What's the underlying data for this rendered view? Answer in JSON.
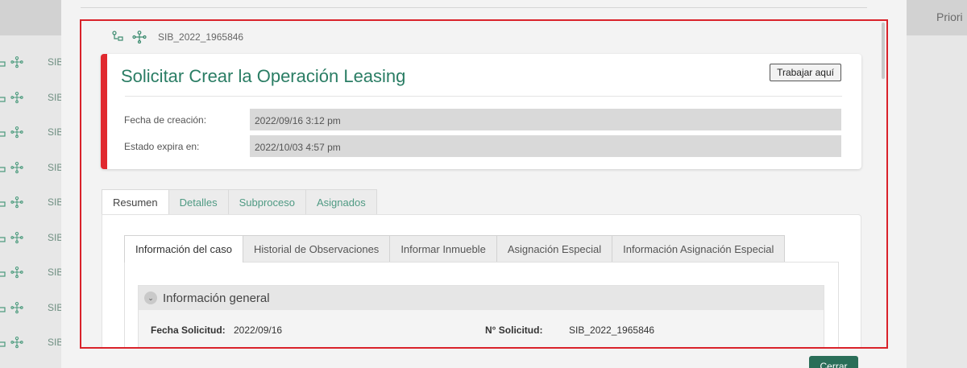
{
  "background": {
    "header_label": "Priori",
    "row_code": "SIB",
    "row_offsets": [
      0,
      1,
      2,
      3,
      4,
      5,
      6,
      7,
      8
    ]
  },
  "breadcrumb": {
    "case_code": "SIB_2022_1965846"
  },
  "card": {
    "title": "Solicitar Crear la Operación Leasing",
    "work_button": "Trabajar aquí",
    "fields": [
      {
        "label": "Fecha de creación:",
        "value": "2022/09/16 3:12 pm"
      },
      {
        "label": "Estado expira en:",
        "value": "2022/10/03 4:57 pm"
      }
    ]
  },
  "tabs": [
    "Resumen",
    "Detalles",
    "Subproceso",
    "Asignados"
  ],
  "subtabs": [
    "Información del caso",
    "Historial de Observaciones",
    "Informar Inmueble",
    "Asignación Especial",
    "Información Asignación Especial"
  ],
  "section": {
    "title": "Información general",
    "fecha_label": "Fecha Solicitud:",
    "fecha_value": "2022/09/16",
    "numero_label": "N° Solicitud:",
    "numero_value": "SIB_2022_1965846"
  },
  "close_button": "Cerrar",
  "colors": {
    "accent_green": "#2a7d64",
    "highlight_red": "#d9222a",
    "card_border": "#e0292f"
  }
}
